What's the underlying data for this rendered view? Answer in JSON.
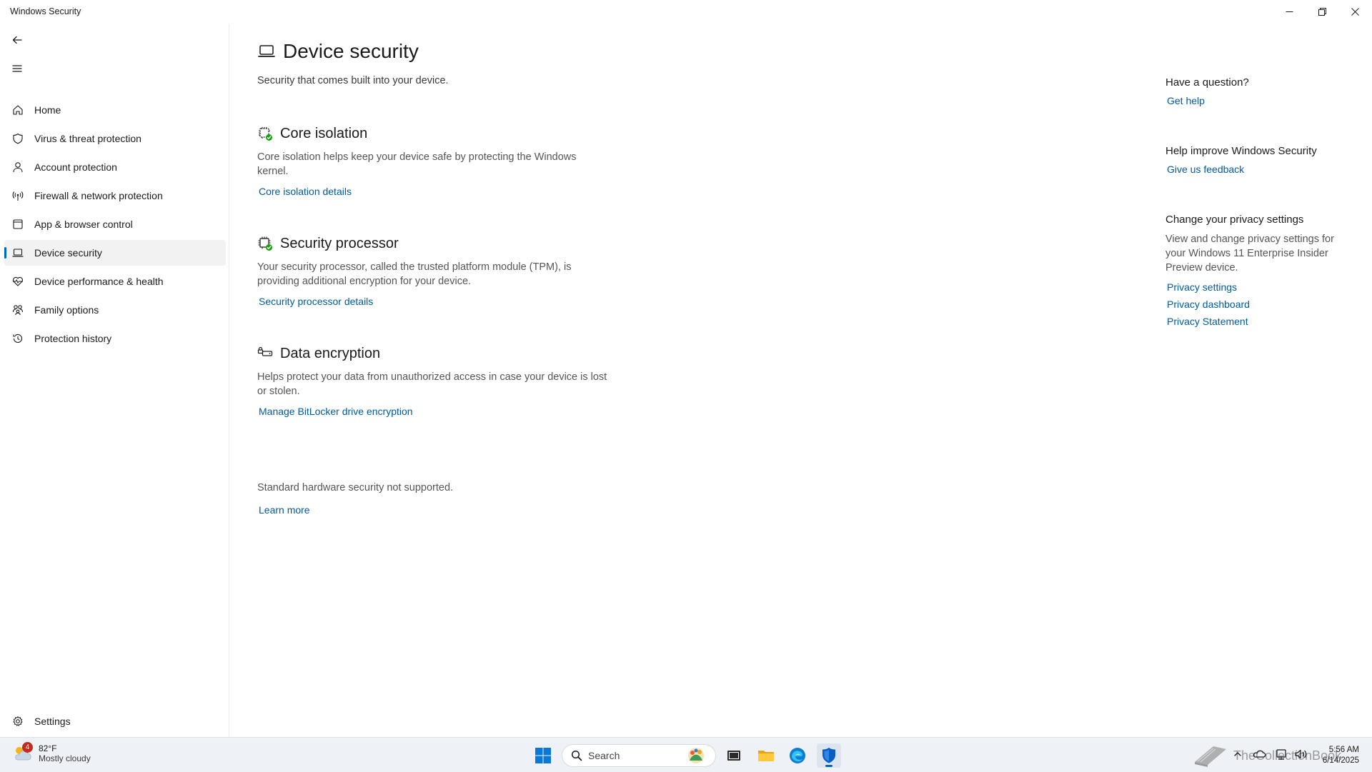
{
  "window": {
    "title": "Windows Security"
  },
  "sidebar": {
    "items": [
      {
        "label": "Home",
        "icon": "home-icon"
      },
      {
        "label": "Virus & threat protection",
        "icon": "shield-icon"
      },
      {
        "label": "Account protection",
        "icon": "person-icon"
      },
      {
        "label": "Firewall & network protection",
        "icon": "antenna-icon"
      },
      {
        "label": "App & browser control",
        "icon": "browser-window-icon"
      },
      {
        "label": "Device security",
        "icon": "laptop-icon",
        "active": true
      },
      {
        "label": "Device performance & health",
        "icon": "heart-pulse-icon"
      },
      {
        "label": "Family options",
        "icon": "family-icon"
      },
      {
        "label": "Protection history",
        "icon": "history-icon"
      }
    ],
    "settings_label": "Settings"
  },
  "main": {
    "title": "Device security",
    "subtitle": "Security that comes built into your device.",
    "sections": [
      {
        "title": "Core isolation",
        "description": "Core isolation helps keep your device safe by protecting the Windows kernel.",
        "link": "Core isolation details"
      },
      {
        "title": "Security processor",
        "description": "Your security processor, called the trusted platform module (TPM), is providing additional encryption for your device.",
        "link": "Security processor details"
      },
      {
        "title": "Data encryption",
        "description": "Helps protect your data from unauthorized access in case your device is lost or stolen.",
        "link": "Manage BitLocker drive encryption"
      }
    ],
    "hardware_note": "Standard hardware security not supported.",
    "learn_more": "Learn more"
  },
  "right_panel": {
    "question": {
      "title": "Have a question?",
      "link": "Get help"
    },
    "improve": {
      "title": "Help improve Windows Security",
      "link": "Give us feedback"
    },
    "privacy": {
      "title": "Change your privacy settings",
      "description": "View and change privacy settings for your Windows 11 Enterprise Insider Preview device.",
      "links": [
        "Privacy settings",
        "Privacy dashboard",
        "Privacy Statement"
      ]
    }
  },
  "taskbar": {
    "weather": {
      "temp": "82°F",
      "condition": "Mostly cloudy",
      "badge": "4"
    },
    "search_label": "Search",
    "time": "5:56 AM",
    "date": "6/14/2025",
    "watermark": "TheCollectionBook"
  },
  "colors": {
    "accent": "#0067c0",
    "link": "#005a9e",
    "status_ok": "#13a10e",
    "badge": "#c42b1c"
  }
}
